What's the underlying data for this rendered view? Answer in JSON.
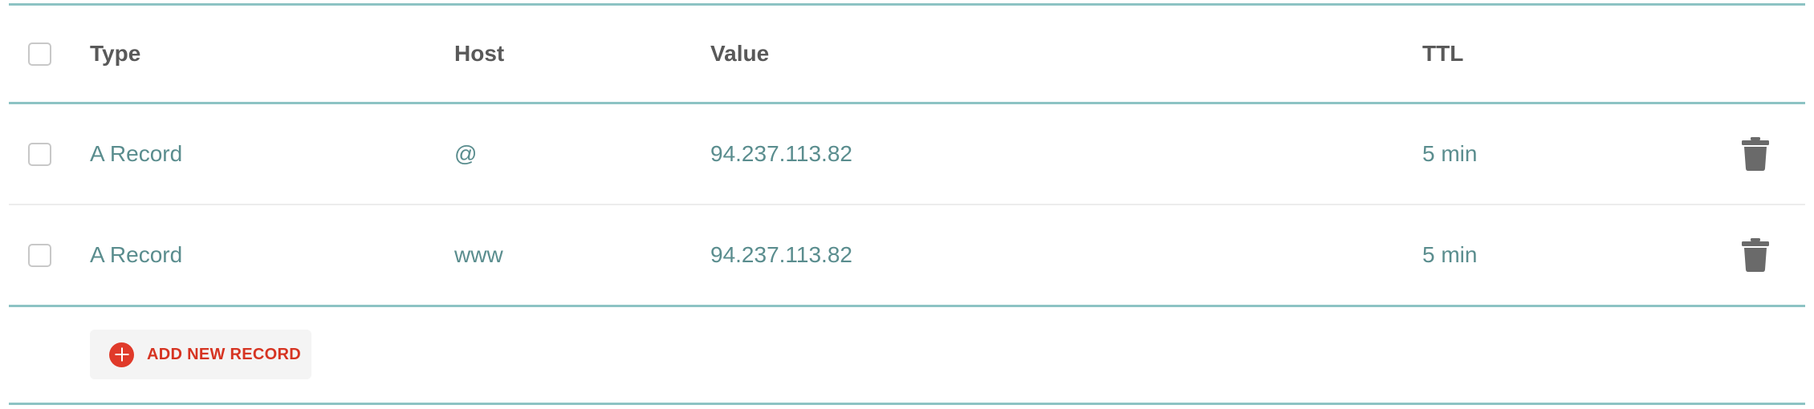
{
  "table": {
    "columns": {
      "type": "Type",
      "host": "Host",
      "value": "Value",
      "ttl": "TTL"
    },
    "rows": [
      {
        "type": "A Record",
        "host": "@",
        "value": "94.237.113.82",
        "ttl": "5 min",
        "checked": false
      },
      {
        "type": "A Record",
        "host": "www",
        "value": "94.237.113.82",
        "ttl": "5 min",
        "checked": false
      }
    ]
  },
  "actions": {
    "add_record_label": "ADD NEW RECORD",
    "add_icon": "plus-circle-icon",
    "delete_icon": "trash-icon"
  },
  "colors": {
    "accent_rule": "#8dc3c4",
    "cell_text": "#5a8d8e",
    "header_text": "#595959",
    "add_button_text": "#d63422",
    "add_icon_bg": "#e03a2a",
    "trash_icon": "#6a6a6a"
  }
}
